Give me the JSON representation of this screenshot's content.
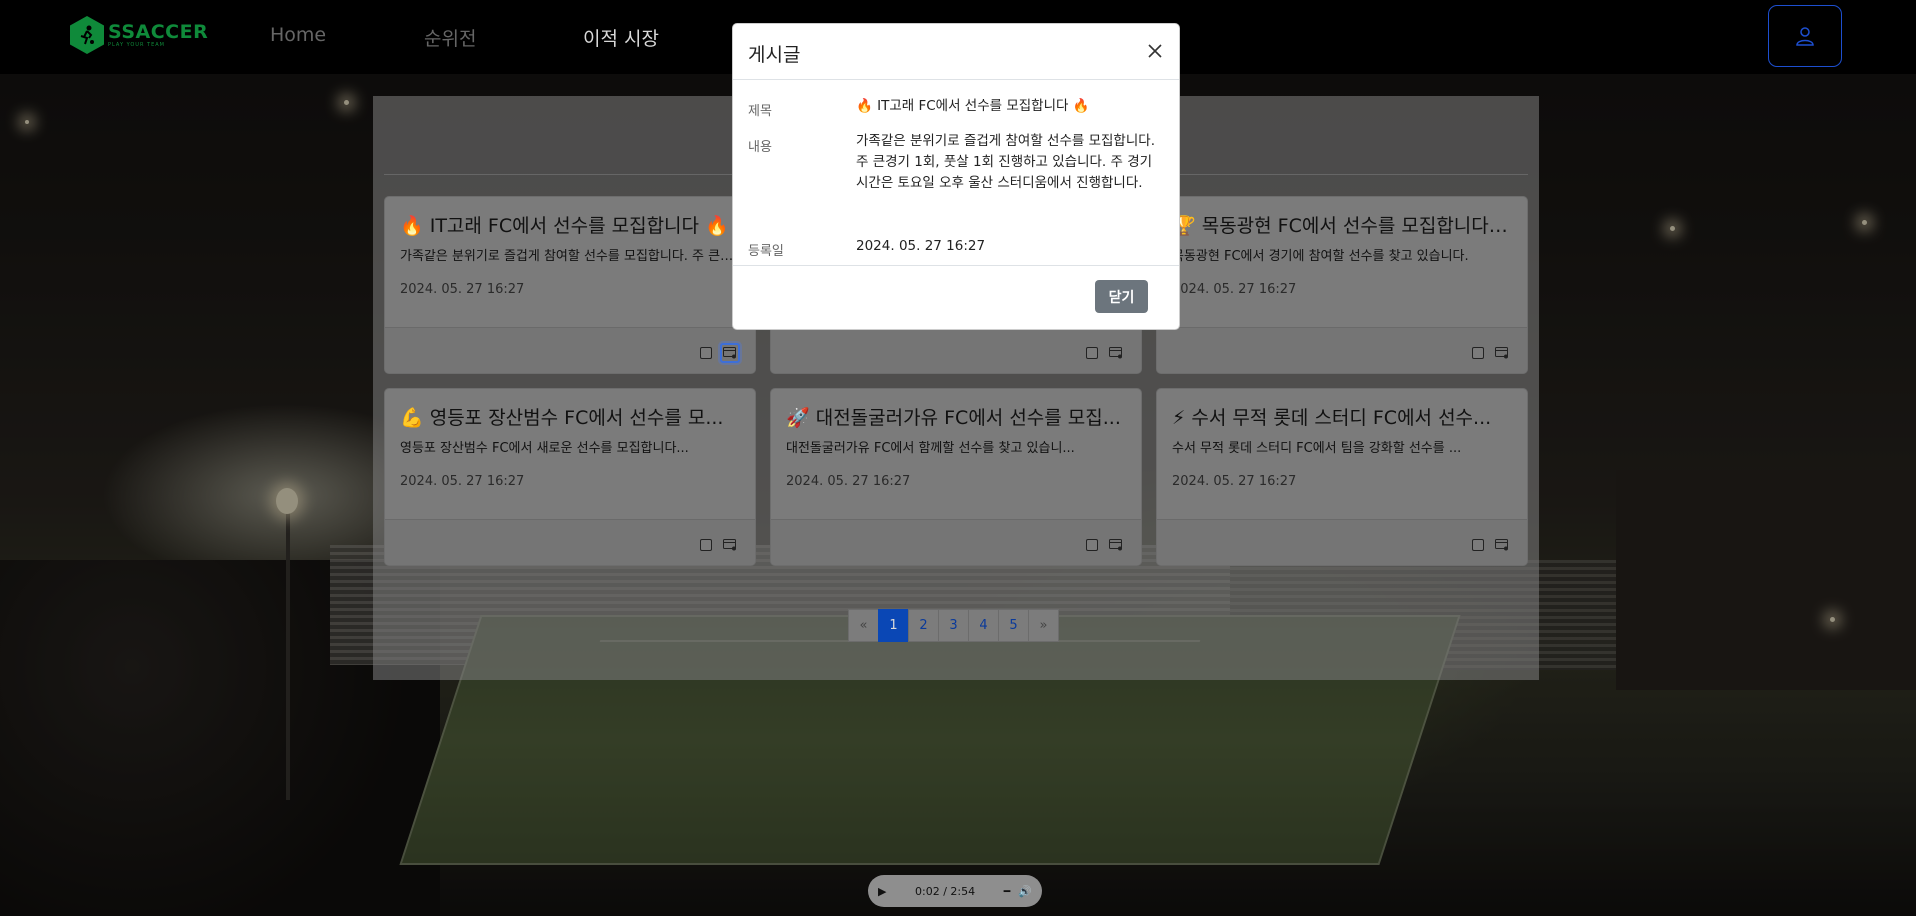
{
  "brand": {
    "name": "SSACCER",
    "tagline": "PLAY YOUR TEAM",
    "color": "#0f8a3a"
  },
  "nav": {
    "home": "Home",
    "ranking": "순위전",
    "transfer": "이적 시장"
  },
  "posts": [
    {
      "emoji": "🔥",
      "title": "IT고래 FC에서 선수를 모집합니다 🔥",
      "desc": "가족같은 분위기로 즐겁게 참여할 선수를 모집합니다. 주 큰경기 1회, 풋살 1회 진행하고 있습니다.",
      "date": "2024. 05. 27 16:27"
    },
    {
      "emoji": "",
      "title": "",
      "desc": "",
      "date": ""
    },
    {
      "emoji": "🏆",
      "title": "목동광현 FC에서 선수를 모집합니다 ...",
      "desc": "목동광현 FC에서 경기에 참여할 선수를 찾고 있습니다.",
      "date": "2024. 05. 27 16:27"
    },
    {
      "emoji": "💪",
      "title": "영등포 장산범수 FC에서 선수를 모...",
      "desc": "영등포 장산범수 FC에서 새로운 선수를 모집합니다...",
      "date": "2024. 05. 27 16:27"
    },
    {
      "emoji": "🚀",
      "title": "대전돌굴러가유 FC에서 선수를 모집...",
      "desc": "대전돌굴러가유 FC에서 함께할 선수를 찾고 있습니...",
      "date": "2024. 05. 27 16:27"
    },
    {
      "emoji": "⚡",
      "title": "수서 무적 롯데 스터디 FC에서 선수...",
      "desc": "수서 무적 롯데 스터디 FC에서 팀을 강화할 선수를 ...",
      "date": "2024. 05. 27 16:27"
    }
  ],
  "pagination": {
    "prev": "«",
    "next": "»",
    "pages": [
      "1",
      "2",
      "3",
      "4",
      "5"
    ],
    "active": "1"
  },
  "audio": {
    "time": "0:02 / 2:54"
  },
  "modal": {
    "title": "게시글",
    "title_label": "제목",
    "title_value": "🔥 IT고래 FC에서 선수를 모집합니다 🔥",
    "content_label": "내용",
    "content_value": "가족같은 분위기로 즐겁게 참여할 선수를 모집합니다. 주 큰경기 1회, 풋살 1회 진행하고 있습니다. 주 경기 시간은 토요일 오후 울산 스터디움에서 진행합니다.",
    "date_label": "등록일",
    "date_value": "2024. 05. 27 16:27",
    "close_button": "닫기"
  },
  "colors": {
    "accent": "#0a47b5",
    "secondary_button": "#6c757d",
    "user_button_border": "#1d4fd0"
  }
}
